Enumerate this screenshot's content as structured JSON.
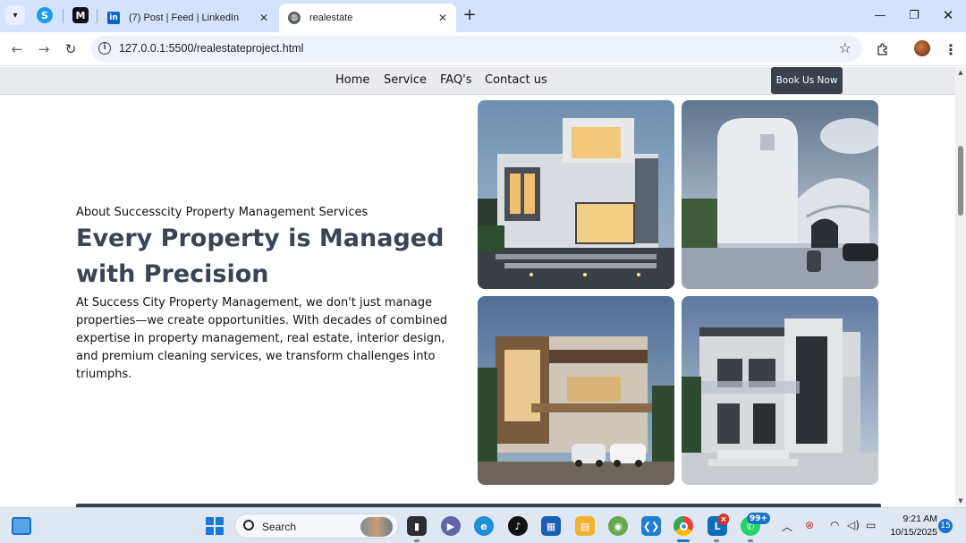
{
  "browser": {
    "tabs": [
      {
        "title": "",
        "favicon": "skype-icon",
        "pinned": true
      },
      {
        "title": "",
        "favicon": "medium-icon",
        "pinned": true
      },
      {
        "title": "(7) Post | Feed | LinkedIn",
        "favicon": "linkedin-icon",
        "active": false
      },
      {
        "title": "realestate",
        "favicon": "globe-icon",
        "active": true
      }
    ],
    "url": "127.0.0.1:5500/realestateproject.html"
  },
  "navbar": {
    "links": [
      "Home",
      "Service",
      "FAQ's",
      "Contact us"
    ],
    "cta": "Book Us Now"
  },
  "about": {
    "subtitle": "About Successcity Property Management Services",
    "title": "Every Property is Managed with Precision",
    "body": "At Success City Property Management, we don't just manage properties—we create opportunities. With decades of combined expertise in property management, real estate, interior design, and premium cleaning services, we transform challenges into triumphs."
  },
  "gallery": [
    {
      "subject": "modern white villa at dusk"
    },
    {
      "subject": "futuristic curved building with car"
    },
    {
      "subject": "wooden facade house with cars"
    },
    {
      "subject": "grey modern two-storey house"
    }
  ],
  "taskbar": {
    "search_label": "Search",
    "apps": [
      "file-explorer-icon",
      "teams-icon",
      "edge-icon",
      "tiktok-icon",
      "store-icon",
      "files-icon",
      "maps-icon",
      "vscode-icon",
      "chrome-icon",
      "outlook-icon",
      "whatsapp-icon"
    ],
    "whatsapp_badge": "99+",
    "outlook_badge": "×",
    "time": "9:21 AM",
    "date": "10/15/2025",
    "notifications": "15"
  },
  "colors": {
    "accent": "#39414d",
    "title": "#3a4454",
    "tabbar": "#d3e3fd"
  }
}
